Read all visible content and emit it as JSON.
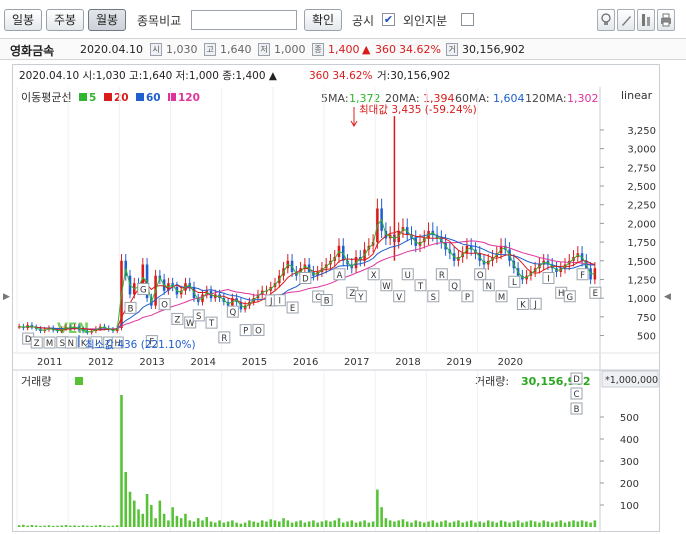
{
  "toolbar": {
    "tabs": [
      "일봉",
      "주봉",
      "월봉"
    ],
    "active_tab": "월봉",
    "compare_label": "종목비교",
    "compare_value": "",
    "confirm_label": "확인",
    "disclosure_label": "공시",
    "disclosure_checked": "✔",
    "foreign_label": "외인지분",
    "foreign_checked": ""
  },
  "stock": {
    "name": "영화금속",
    "date": "2020.04.10",
    "open": "1,030",
    "high": "1,640",
    "low": "1,000",
    "close": "1,400",
    "change_arrow": "▲",
    "change": "360",
    "change_pct": "34.62%",
    "volume": "30,156,902"
  },
  "chart": {
    "header_line": "2020.04.10  시:1,030  고:1,640  저:1,000  종:1,400 ▲",
    "header_change": "360  34.62%",
    "header_volume": "거:30,156,902",
    "ma_label": "이동평균선",
    "ma_legend": [
      {
        "label": "5",
        "color": "#2fb52f"
      },
      {
        "label": "20",
        "color": "#d81c1c"
      },
      {
        "label": "60",
        "color": "#1f5fcf"
      },
      {
        "label": "120",
        "color": "#e0339a"
      }
    ],
    "ma_values": {
      "ma5_label": "5MA:",
      "ma5": "1,372",
      "ma20_label": "20MA:",
      "ma20": "1,394",
      "ma60_label": "60MA:",
      "ma60": "1,604",
      "ma120_label": "120MA:",
      "ma120": "1,302"
    },
    "scale_label": "linear",
    "max_annotation": "최대값 3,435 (-59.24%)",
    "min_annotation": "최소값 436 (221.10%)",
    "watermark": "VEN",
    "y_ticks": [
      "3,250",
      "3,000",
      "2,750",
      "2,500",
      "2,250",
      "2,000",
      "1,750",
      "1,500",
      "1,250",
      "1,000",
      "750",
      "500"
    ],
    "x_ticks": [
      "2011",
      "2012",
      "2013",
      "2014",
      "2015",
      "2016",
      "2017",
      "2018",
      "2019",
      "2020"
    ],
    "volume_label": "거래량",
    "volume_value_label": "거래량:",
    "volume_value": "30,156,902",
    "volume_unit": "*1,000,000",
    "volume_ticks": [
      "500",
      "400",
      "300",
      "200",
      "100"
    ],
    "event_markers_top": [
      "D",
      "Z",
      "M",
      "S",
      "N",
      "K",
      "I",
      "C",
      "H",
      "B",
      "G",
      "F",
      "O",
      "Z",
      "W",
      "S",
      "T",
      "R",
      "Q",
      "P",
      "O",
      "J",
      "I",
      "E",
      "D",
      "C",
      "B",
      "A",
      "Z",
      "Y",
      "X",
      "W",
      "V",
      "U",
      "T",
      "S",
      "R",
      "Q",
      "P",
      "O",
      "N",
      "M",
      "L",
      "K",
      "J",
      "I",
      "H",
      "G",
      "F",
      "E"
    ],
    "event_markers_vol": [
      "D",
      "C",
      "B"
    ]
  },
  "colors": {
    "up": "#d81c1c",
    "down": "#1f5fcf",
    "ma5": "#2fb52f",
    "ma20": "#d81c1c",
    "ma60": "#1f5fcf",
    "ma120": "#e0339a",
    "volume": "#57c236"
  },
  "chart_data": {
    "type": "candlestick",
    "price_series_monthly_close": [
      620,
      600,
      640,
      610,
      590,
      560,
      580,
      600,
      570,
      560,
      590,
      610,
      600,
      620,
      580,
      560,
      540,
      560,
      590,
      620,
      600,
      580,
      560,
      600,
      1500,
      1300,
      1050,
      1200,
      1100,
      1450,
      1000,
      900,
      1300,
      1250,
      1100,
      1200,
      1150,
      1050,
      1100,
      1200,
      1150,
      1000,
      950,
      1050,
      1100,
      1000,
      1050,
      1000,
      950,
      900,
      1000,
      950,
      850,
      900,
      950,
      1000,
      1050,
      1100,
      1100,
      1150,
      1200,
      1300,
      1400,
      1500,
      1350,
      1300,
      1400,
      1450,
      1350,
      1300,
      1350,
      1400,
      1450,
      1500,
      1550,
      1700,
      1500,
      1450,
      1400,
      1550,
      1500,
      1650,
      1700,
      1750,
      2200,
      1900,
      1800,
      1850,
      1750,
      1900,
      1950,
      1850,
      1800,
      1700,
      1750,
      1800,
      1900,
      1850,
      1800,
      1750,
      1650,
      1600,
      1500,
      1550,
      1600,
      1700,
      1650,
      1600,
      1500,
      1450,
      1500,
      1550,
      1600,
      1700,
      1650,
      1500,
      1400,
      1300,
      1250,
      1300,
      1350,
      1400,
      1450,
      1500,
      1450,
      1400,
      1350,
      1400,
      1450,
      1500,
      1550,
      1600,
      1500,
      1400,
      1250,
      1400
    ],
    "max_value": 3435,
    "min_value": 436,
    "y_range": [
      400,
      3450
    ],
    "x_years": [
      "2011",
      "2012",
      "2013",
      "2014",
      "2015",
      "2016",
      "2017",
      "2018",
      "2019",
      "2020"
    ],
    "volume_millions": [
      8,
      10,
      6,
      9,
      7,
      5,
      6,
      8,
      5,
      6,
      7,
      9,
      6,
      7,
      5,
      8,
      6,
      5,
      7,
      9,
      6,
      5,
      6,
      8,
      600,
      250,
      160,
      120,
      80,
      60,
      150,
      100,
      40,
      120,
      60,
      30,
      90,
      50,
      40,
      60,
      30,
      25,
      40,
      30,
      45,
      25,
      20,
      30,
      20,
      25,
      30,
      20,
      15,
      20,
      30,
      25,
      20,
      30,
      25,
      35,
      30,
      25,
      40,
      30,
      20,
      25,
      30,
      20,
      25,
      30,
      20,
      25,
      30,
      25,
      30,
      40,
      20,
      25,
      30,
      20,
      25,
      30,
      20,
      25,
      170,
      90,
      40,
      30,
      25,
      30,
      35,
      25,
      20,
      30,
      25,
      20,
      25,
      30,
      20,
      25,
      30,
      20,
      25,
      30,
      20,
      25,
      30,
      20,
      25,
      20,
      30,
      25,
      20,
      30,
      25,
      20,
      25,
      30,
      20,
      25,
      30,
      25,
      20,
      30,
      25,
      20,
      25,
      30,
      20,
      25,
      30,
      25,
      30,
      25,
      20,
      30
    ],
    "volume_range": [
      0,
      600
    ]
  }
}
